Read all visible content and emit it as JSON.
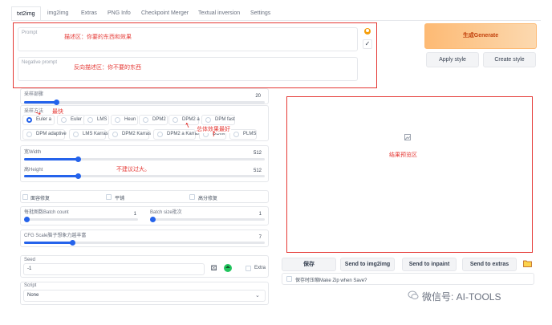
{
  "tabs": [
    {
      "label": "txt2img"
    },
    {
      "label": "img2img"
    },
    {
      "label": "Extras"
    },
    {
      "label": "PNG Info"
    },
    {
      "label": "Checkpoint Merger"
    },
    {
      "label": "Textual inversion"
    },
    {
      "label": "Settings"
    }
  ],
  "prompt": {
    "label": "Prompt",
    "annotation": "描述区：你要的东西和效果",
    "negative_label": "Negative prompt",
    "negative_annotation": "反向描述区：你不要的东西"
  },
  "actions": {
    "generate": "生成Generate",
    "apply_style": "Apply style",
    "create_style": "Create style"
  },
  "sampling_steps": {
    "label": "采样部骤",
    "value": "20",
    "fraction": 0.133
  },
  "sampler": {
    "label": "采样方法",
    "annotation_fast": "最快",
    "annotation_best": "总体效果最好",
    "options": [
      "Euler a",
      "Euler",
      "LMS",
      "Heun",
      "DPM2",
      "DPM2 a",
      "DPM fast",
      "DPM adaptive",
      "LMS Karras",
      "DPM2 Karras",
      "DPM2 a Karras",
      "DDIM",
      "PLMS"
    ],
    "selected": "Euler a"
  },
  "width": {
    "label": "宽Width",
    "value": "512",
    "fraction": 0.222
  },
  "height": {
    "label": "高Height",
    "value": "512",
    "fraction": 0.222,
    "annotation": "不建议过大。"
  },
  "checks": {
    "restore_faces": "面容修复",
    "tiling": "平铺",
    "highres": "高分修复"
  },
  "batch_count": {
    "label": "每批图数Batch count",
    "value": "1",
    "fraction": 0.0
  },
  "batch_size": {
    "label": "Batch size批次",
    "value": "1",
    "fraction": 0.0
  },
  "cfg": {
    "label": "CFG Scale脑子想象力越丰富",
    "value": "7",
    "fraction": 0.2
  },
  "seed": {
    "label": "Seed",
    "value": "-1",
    "extra_label": "Extra"
  },
  "script": {
    "label": "Script",
    "value": "None"
  },
  "output": {
    "annotation": "结果预览区"
  },
  "output_buttons": {
    "save": "保存",
    "send_img2img": "Send to img2img",
    "send_inpaint": "Send to inpaint",
    "send_extras": "Send to extras"
  },
  "save_zip": "保存时压缩Make Zip when Save?",
  "watermark": "微信号: AI-TOOLS",
  "colors": {
    "accent": "#2563eb",
    "generate": "#fdba74",
    "annotation": "#e53935"
  }
}
